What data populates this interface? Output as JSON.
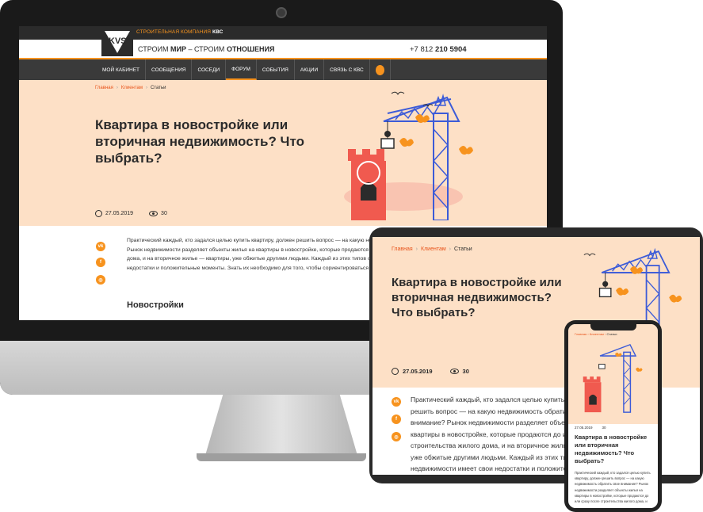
{
  "site": {
    "company_prefix": "СТРОИТЕЛЬНАЯ КОМПАНИЯ ",
    "company_name": "КВС",
    "logo_text": "KVS",
    "slogan_a": "СТРОИМ ",
    "slogan_b": "МИР",
    "slogan_c": " – СТРОИМ ",
    "slogan_d": "ОТНОШЕНИЯ",
    "phone_prefix": "+7 812 ",
    "phone_number": "210 5904",
    "nav": [
      "МОЙ КАБИНЕТ",
      "СООБЩЕНИЯ",
      "СОСЕДИ",
      "ФОРУМ",
      "СОБЫТИЯ",
      "АКЦИИ",
      "СВЯЗЬ С КВС"
    ],
    "active_nav": "ФОРУМ"
  },
  "breadcrumb": {
    "home": "Главная",
    "clients": "Клиентам",
    "current": "Статьи",
    "sep": "›"
  },
  "article": {
    "title": "Квартира в новостройке или вторичная недвижимость? Что выбрать?",
    "date": "27.05.2019",
    "views": "30",
    "desktop_text": "Практический каждый, кто задался целью купить квартиру, должен решить вопрос — на какую недвижимость обратить свое внимание? Рынок недвижимости разделяет объекты жилья на квартиры в новостройке, которые продаются до или сразу после строительства жилого дома, и на вторичное жилье — квартиры, уже обжитые другими людьми. Каждый из этих типов объектов недвижимости имеет свои недостатки и положительные моменты. Знать их необходимо для того, чтобы сориентироваться в выборе подходящего жилья.",
    "tablet_text": "Практический каждый, кто задался целью купить квартиру, должен решить вопрос — на какую недвижимость обратить свое внимание? Рынок недвижимости разделяет объекты жилья на квартиры в новостройке, которые продаются до или сразу после строительства жилого дома, и на вторичное жилье — квартиры, уже обжитые другими людьми. Каждый из этих типов объектов недвижимости имеет свои недостатки и положительные моменты. Знать их необходимо для того, чтобы сориентироваться в выборе подходящего жилья.",
    "phone_text": "Практический каждый, кто задался целью купить квартиру, должен решить вопрос — на какую недвижимость обратить свое внимание? Рынок недвижимости разделяет объекты жилья на квартиры в новостройке, которые продаются до или сразу после строительства жилого дома, и",
    "section_heading": "Новостройки"
  },
  "social": {
    "vk": "vk",
    "facebook": "f",
    "instagram": "◎"
  },
  "colors": {
    "accent": "#f7931e",
    "link": "#e8531a",
    "hero_bg": "#fde0c6",
    "dark": "#2b2b2b",
    "tower_red": "#f05a4f",
    "crane_blue": "#3c5bd8"
  }
}
